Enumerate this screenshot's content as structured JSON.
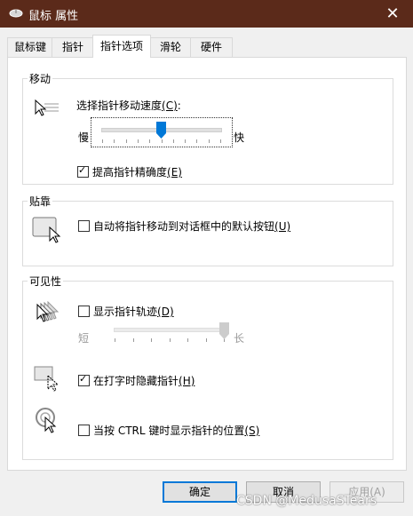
{
  "window": {
    "title": "鼠标 属性",
    "close_symbol": "✕"
  },
  "tabs": [
    "鼠标键",
    "指针",
    "指针选项",
    "滑轮",
    "硬件"
  ],
  "active_tab": "指针选项",
  "motion": {
    "group_label": "移动",
    "speed_label": "选择指针移动速度",
    "speed_key": "(C)",
    "speed_suffix": ":",
    "slow_label": "慢",
    "fast_label": "快",
    "speed_value": 0.5,
    "precision_label": "提高指针精确度",
    "precision_key": "(E)",
    "precision_checked": true
  },
  "snap": {
    "group_label": "贴靠",
    "snap_label": "自动将指针移动到对话框中的默认按钮",
    "snap_key": "(U)",
    "snap_checked": false
  },
  "visibility": {
    "group_label": "可见性",
    "trails_label": "显示指针轨迹",
    "trails_key": "(D)",
    "trails_checked": false,
    "short_label": "短",
    "long_label": "长",
    "trails_value": 1.0,
    "hide_label": "在打字时隐藏指针",
    "hide_key": "(H)",
    "hide_checked": true,
    "ctrl_label": "当按 CTRL 键时显示指针的位置",
    "ctrl_key": "(S)",
    "ctrl_checked": false
  },
  "buttons": {
    "ok": "确定",
    "cancel": "取消",
    "apply": "应用(A)"
  },
  "watermark": "CSDN @MedusaSTears",
  "colors": {
    "titlebar": "#5b2a1a",
    "accent": "#0078d7"
  }
}
